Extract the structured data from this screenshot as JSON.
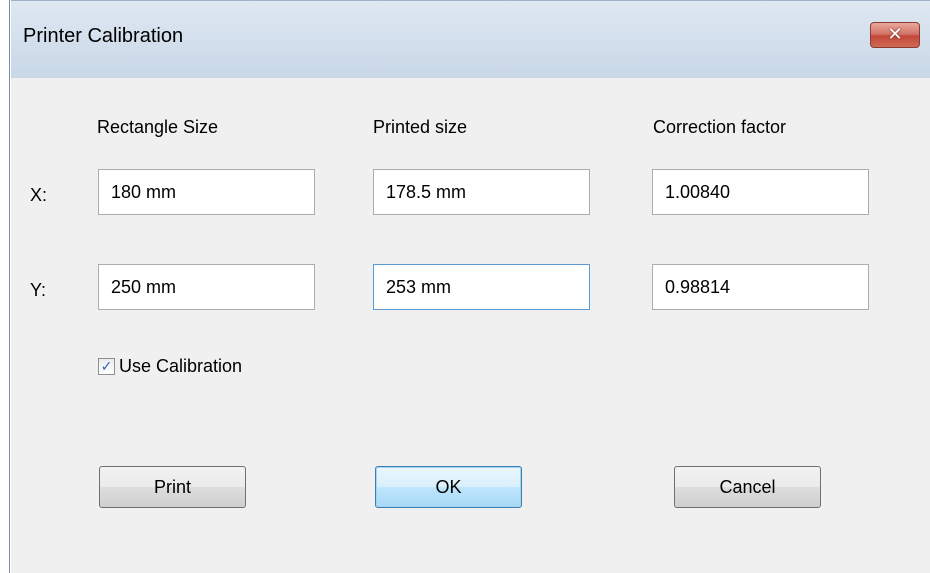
{
  "window": {
    "title": "Printer Calibration",
    "close_glyph": "✕"
  },
  "columns": {
    "rectangle_size": "Rectangle Size",
    "printed_size": "Printed size",
    "correction_factor": "Correction factor"
  },
  "rows": {
    "x": {
      "label": "X:",
      "rectangle_size": "180 mm",
      "printed_size": "178.5 mm",
      "correction_factor": "1.00840"
    },
    "y": {
      "label": "Y:",
      "rectangle_size": "250 mm",
      "printed_size": "253 mm",
      "correction_factor": "0.98814"
    }
  },
  "use_calibration": {
    "label": "Use Calibration",
    "checked": true,
    "check_glyph": "✓"
  },
  "buttons": {
    "print": "Print",
    "ok": "OK",
    "cancel": "Cancel"
  },
  "colors": {
    "dialog_background": "#f0f0f0",
    "close_button": "#c3493a",
    "focus_border": "#5b9bd5",
    "default_button_border": "#3c7fb1"
  }
}
